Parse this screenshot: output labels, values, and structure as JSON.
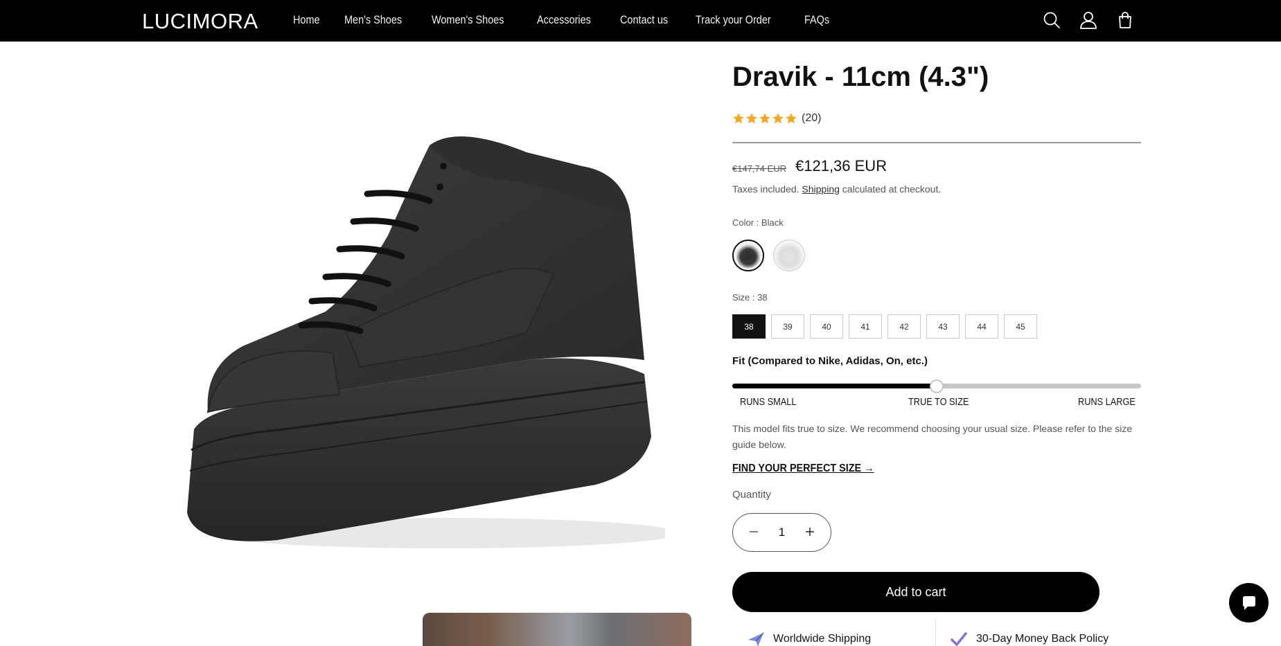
{
  "header": {
    "logo": "LUCIMORA",
    "nav": [
      "Home",
      "Men's Shoes",
      "Women's Shoes",
      "Accessories",
      "Contact us",
      "Track your Order",
      "FAQs"
    ],
    "icons": [
      "search-icon",
      "account-icon",
      "cart-icon"
    ],
    "background": "#000000"
  },
  "product": {
    "title": "Dravik - 11cm (4.3\")",
    "rating": {
      "stars": 5,
      "count": "(20)",
      "star_color": "#F5A623"
    },
    "price_old": "€147,74 EUR",
    "price_new": "€121,36 EUR",
    "tax_prefix": "Taxes included.",
    "tax_link": "Shipping",
    "tax_suffix": "calculated at checkout.",
    "color_label": "Color : Black",
    "colors": [
      "Black",
      "White"
    ],
    "selected_color": "Black",
    "size_label": "Size : 38",
    "sizes": [
      "38",
      "39",
      "40",
      "41",
      "42",
      "43",
      "44",
      "45"
    ],
    "selected_size": "38",
    "fit": {
      "title": "Fit (Compared to Nike, Adidas, On, etc.)",
      "labels": [
        "RUNS SMALL",
        "TRUE TO SIZE",
        "RUNS LARGE"
      ],
      "value": 0.5,
      "description": "This model fits true to size. We recommend choosing your usual size. Please refer to the size guide below.",
      "link": "FIND YOUR PERFECT SIZE →"
    },
    "quantity_label": "Quantity",
    "quantity": "1",
    "add_to_cart": "Add to cart",
    "perks": [
      {
        "icon": "plane-icon",
        "label": "Worldwide Shipping"
      },
      {
        "icon": "check-icon",
        "label": "30-Day Money Back Policy"
      }
    ]
  },
  "chat": {
    "icon": "chat-icon"
  }
}
